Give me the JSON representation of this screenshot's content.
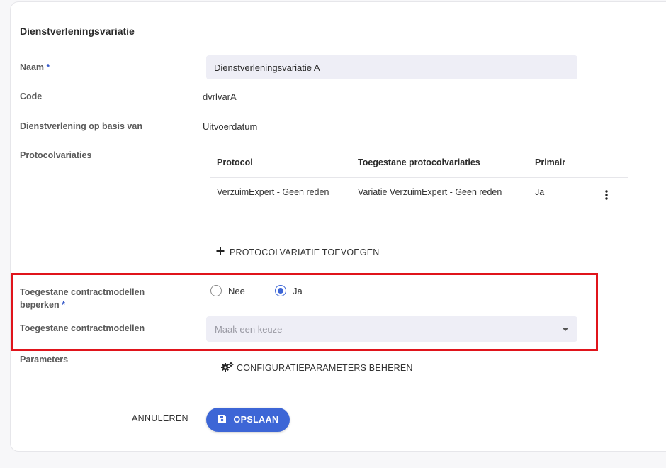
{
  "section": {
    "title": "Dienstverleningsvariatie"
  },
  "fields": {
    "naam": {
      "label": "Naam",
      "required_marker": "*",
      "value": "Dienstverleningsvariatie A"
    },
    "code": {
      "label": "Code",
      "value": "dvrlvarA"
    },
    "basis": {
      "label": "Dienstverlening op basis van",
      "value": "Uitvoerdatum"
    },
    "protocolvariaties": {
      "label": "Protocolvariaties",
      "table": {
        "headers": [
          "Protocol",
          "Toegestane protocolvariaties",
          "Primair"
        ],
        "rows": [
          [
            "VerzuimExpert - Geen reden",
            "Variatie VerzuimExpert - Geen reden",
            "Ja"
          ]
        ]
      },
      "add_label": "PROTOCOLVARIATIE TOEVOEGEN"
    },
    "beperken": {
      "label_line1": "Toegestane contractmodellen",
      "label_line2": "beperken",
      "required_marker": "*",
      "options": [
        "Nee",
        "Ja"
      ],
      "selected": "Ja"
    },
    "contractmodellen": {
      "label": "Toegestane contractmodellen",
      "placeholder": "Maak een keuze"
    },
    "parameters": {
      "label": "Parameters",
      "button_label": "CONFIGURATIEPARAMETERS BEHEREN"
    }
  },
  "actions": {
    "cancel_label": "ANNULEREN",
    "save_label": "OPSLAAN"
  },
  "icons": {
    "add": "plus-icon",
    "more": "kebab-menu-icon",
    "settings": "gears-icon",
    "save": "floppy-disk-icon",
    "dropdown": "caret-down-icon"
  },
  "colors": {
    "accent": "#3d66d6",
    "required": "#3559c9",
    "highlight_border": "#e0141b",
    "input_bg": "#eeeef6"
  }
}
